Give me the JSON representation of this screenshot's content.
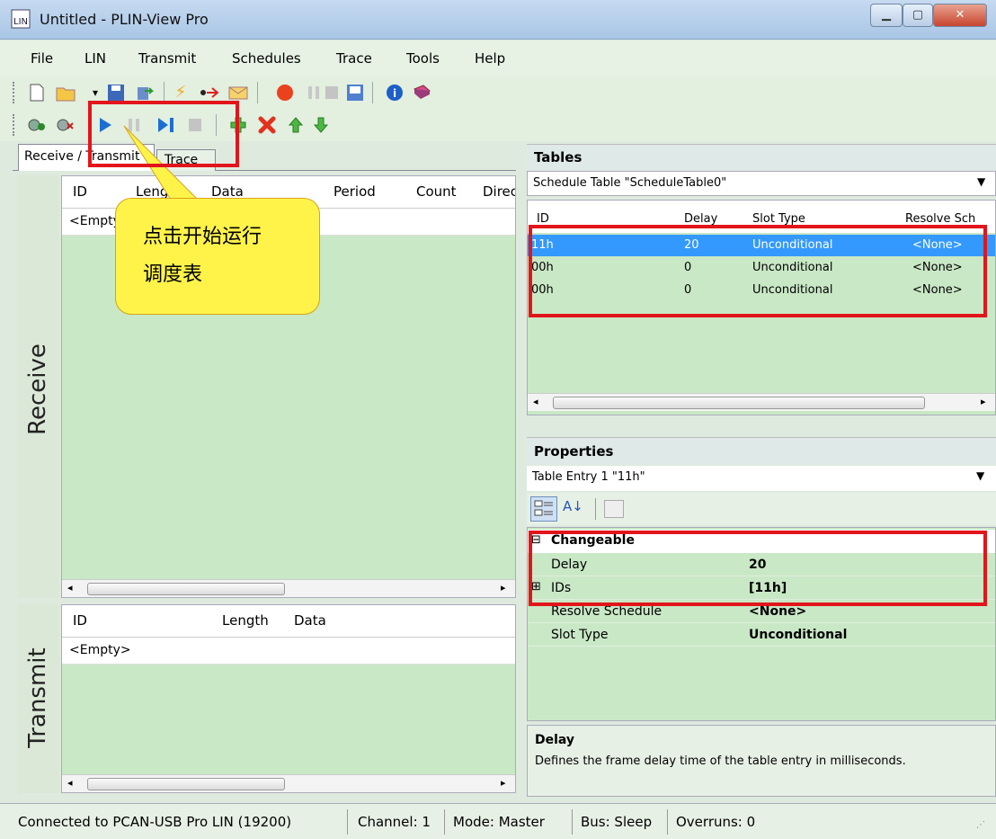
{
  "window": {
    "title": "Untitled - PLIN-View Pro"
  },
  "menu": [
    "File",
    "LIN",
    "Transmit",
    "Schedules",
    "Trace",
    "Tools",
    "Help"
  ],
  "tabs": {
    "receive_transmit": "Receive / Transmit",
    "trace": "Trace"
  },
  "receive": {
    "label": "Receive",
    "columns": [
      "ID",
      "Length",
      "Data",
      "Period",
      "Count",
      "Direction"
    ],
    "empty": "<Empty>"
  },
  "transmit": {
    "label": "Transmit",
    "columns": [
      "ID",
      "Length",
      "Data"
    ],
    "empty": "<Empty>"
  },
  "callout": {
    "line1": "点击开始运行",
    "line2": "调度表"
  },
  "tables": {
    "title": "Tables",
    "selected": "Schedule Table \"ScheduleTable0\"",
    "columns": [
      "ID",
      "Delay",
      "Slot Type",
      "Resolve Sch"
    ],
    "rows": [
      {
        "id": "11h",
        "delay": "20",
        "slot": "Unconditional",
        "resolve": "<None>"
      },
      {
        "id": "00h",
        "delay": "0",
        "slot": "Unconditional",
        "resolve": "<None>"
      },
      {
        "id": "00h",
        "delay": "0",
        "slot": "Unconditional",
        "resolve": "<None>"
      }
    ]
  },
  "properties": {
    "title": "Properties",
    "selected": "Table Entry 1 \"11h\"",
    "category": "Changeable",
    "items": [
      {
        "name": "Delay",
        "value": "20"
      },
      {
        "name": "IDs",
        "value": "[11h]"
      },
      {
        "name": "Resolve Schedule",
        "value": "<None>"
      },
      {
        "name": "Slot Type",
        "value": "Unconditional"
      }
    ],
    "desc_title": "Delay",
    "desc_text": "Defines the frame delay time of the table entry in milliseconds."
  },
  "status": {
    "connection": "Connected to PCAN-USB Pro LIN (19200)",
    "channel": "Channel: 1",
    "mode": "Mode: Master",
    "bus": "Bus: Sleep",
    "overruns": "Overruns: 0"
  },
  "colors": {
    "accent_red": "#e2151b",
    "selection_blue": "#3399ff",
    "grid_green": "#c9e8c6"
  }
}
